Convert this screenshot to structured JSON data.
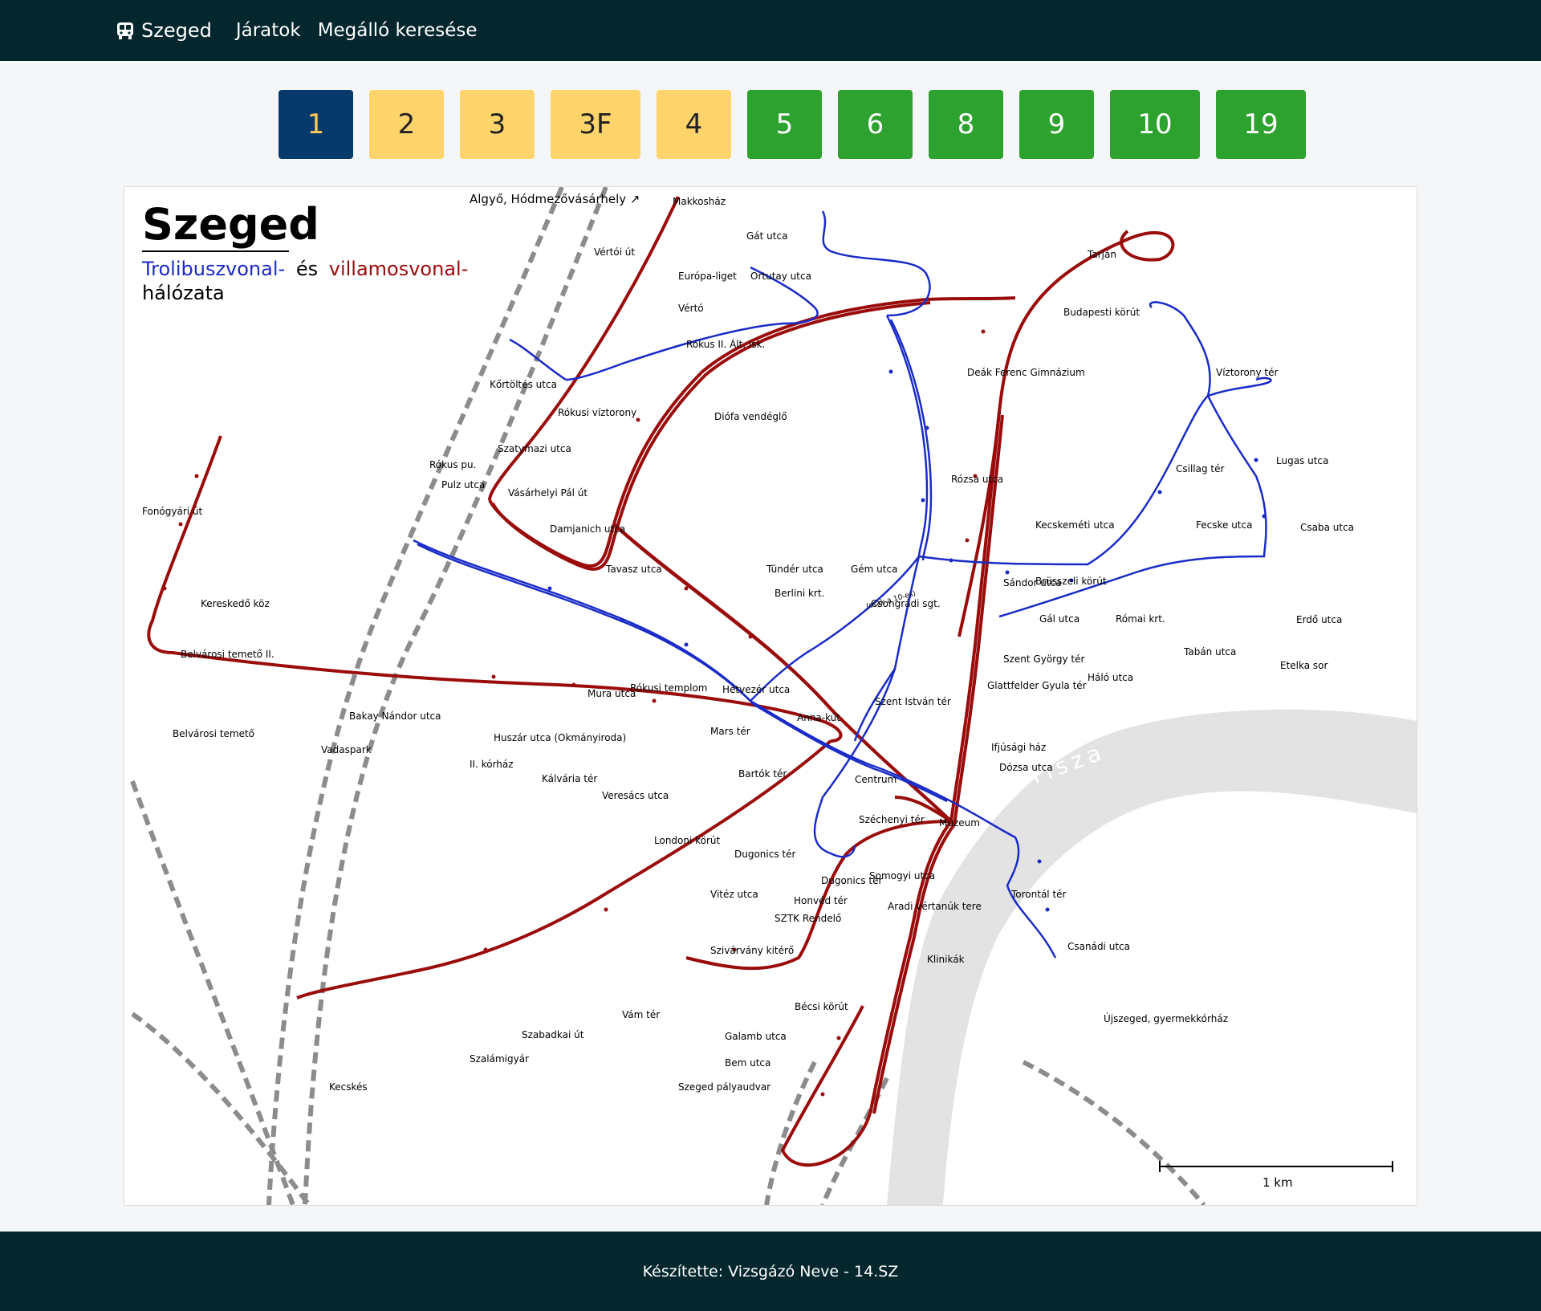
{
  "navbar": {
    "brand": "Szeged",
    "links": [
      "Járatok",
      "Megálló keresése"
    ]
  },
  "routes": [
    {
      "label": "1",
      "type": "tram",
      "active": true
    },
    {
      "label": "2",
      "type": "tram",
      "active": false
    },
    {
      "label": "3",
      "type": "tram",
      "active": false
    },
    {
      "label": "3F",
      "type": "tram",
      "active": false
    },
    {
      "label": "4",
      "type": "tram",
      "active": false
    },
    {
      "label": "5",
      "type": "trolleybus",
      "active": false
    },
    {
      "label": "6",
      "type": "trolleybus",
      "active": false
    },
    {
      "label": "8",
      "type": "trolleybus",
      "active": false
    },
    {
      "label": "9",
      "type": "trolleybus",
      "active": false
    },
    {
      "label": "10",
      "type": "trolleybus",
      "active": false
    },
    {
      "label": "19",
      "type": "trolleybus",
      "active": false
    }
  ],
  "colors": {
    "navbar": "#04262d",
    "active_bg": "#063a6a",
    "active_text": "#ffc857",
    "tram_bg": "#ffd46b",
    "trolley_bg": "#2ea22e",
    "tram_line": "#9a0c0c",
    "trolley_line": "#1a2bc8"
  },
  "map": {
    "title": "Szeged",
    "subtitle_trolley": "Trolibuszvonal-",
    "subtitle_and": "és",
    "subtitle_tram": "villamosvonal-",
    "subtitle_line2": "hálózata",
    "river": "Tisza",
    "scale": "1 km",
    "direction_hint": "Algyő, Hódmezővásárhely ↗",
    "note_10": "(csak a 10-es)",
    "stops": [
      "Makkosház",
      "Gát utca",
      "Ortutay utca",
      "Vértói út",
      "Európa-liget",
      "Vértó",
      "Rókus II. Ált. isk.",
      "Kőrtöltés utca",
      "Rókusi víztorony",
      "Diófa vendéglő",
      "Szatymazi utca",
      "Rókus pu.",
      "Pulz utca",
      "Vásárhelyi Pál út",
      "Damjanich utca",
      "Tavasz utca",
      "Rózsa utca",
      "Tündér utca",
      "Gém utca",
      "Berlini krt.",
      "Csongrádi sgt.",
      "Sándor utca",
      "Brüsszeli körút",
      "Gál utca",
      "Római krt.",
      "Szent György tér",
      "Glattfelder Gyula tér",
      "Háló utca",
      "Tabán utca",
      "Etelka sor",
      "Erdő utca",
      "Csaba utca",
      "Fecske utca",
      "Csillag tér",
      "Lugas utca",
      "Víztorony tér",
      "Kecskeméti utca",
      "Deák Ferenc Gimnázium",
      "Budapesti körút",
      "Tarján",
      "Fonógyári út",
      "Kereskedő köz",
      "Belvárosi temető II.",
      "Belvárosi temető",
      "Vadaspark",
      "II. kórház",
      "Kálvária tér",
      "Veresács utca",
      "Londoni körút",
      "Dugonics tér",
      "Bakay Nándor utca",
      "Mura utca",
      "Huszár utca (Okmányiroda)",
      "Rókusi templom",
      "Hétvezér utca",
      "Mars tér",
      "Anna-kút",
      "Szent István tér",
      "Bartók tér",
      "Centrum",
      "Széchenyi tér",
      "Múzeum",
      "Ifjúsági ház",
      "Dózsa utca",
      "Somogyi utca",
      "Dugonics tér",
      "Honvéd tér",
      "SZTK Rendelő",
      "Aradi vértanúk tere",
      "Klinikák",
      "Vitéz utca",
      "Szivárvány kitérő",
      "Vám tér",
      "Szabadkai út",
      "Szalámigyár",
      "Kecskés",
      "Bécsi körút",
      "Galamb utca",
      "Bem utca",
      "Szeged pályaudvar",
      "Torontál tér",
      "Csanádi utca",
      "Újszeged, gyermekkórház"
    ]
  },
  "footer": "Készítette: Vizsgázó Neve - 14.SZ"
}
